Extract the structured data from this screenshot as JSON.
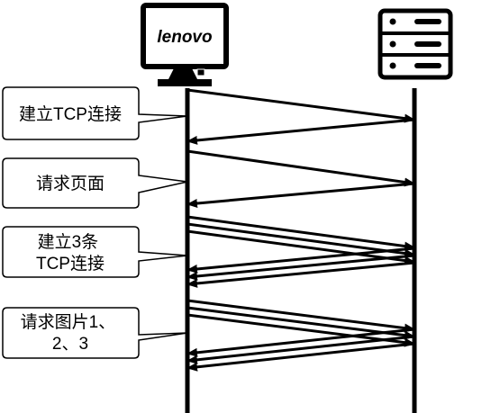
{
  "client": {
    "icon": "monitor-icon",
    "brand_text": "lenovo"
  },
  "server": {
    "icon": "server-rack-icon"
  },
  "steps": [
    {
      "name": "tcp-handshake",
      "lines": [
        "建立TCP连接"
      ],
      "arrows": [
        {
          "from": "client",
          "to": "server"
        },
        {
          "from": "server",
          "to": "client"
        }
      ]
    },
    {
      "name": "request-page",
      "lines": [
        "请求页面"
      ],
      "arrows": [
        {
          "from": "client",
          "to": "server"
        },
        {
          "from": "server",
          "to": "client"
        }
      ]
    },
    {
      "name": "three-tcp-connections",
      "lines": [
        "建立3条",
        "TCP连接"
      ],
      "arrows": [
        {
          "from": "client",
          "to": "server"
        },
        {
          "from": "client",
          "to": "server"
        },
        {
          "from": "client",
          "to": "server"
        },
        {
          "from": "server",
          "to": "client"
        },
        {
          "from": "server",
          "to": "client"
        },
        {
          "from": "server",
          "to": "client"
        }
      ]
    },
    {
      "name": "request-images",
      "lines": [
        "请求图片1、",
        "2、3"
      ],
      "arrows": [
        {
          "from": "client",
          "to": "server"
        },
        {
          "from": "client",
          "to": "server"
        },
        {
          "from": "client",
          "to": "server"
        },
        {
          "from": "server",
          "to": "client"
        },
        {
          "from": "server",
          "to": "client"
        },
        {
          "from": "server",
          "to": "client"
        }
      ]
    }
  ],
  "colors": {
    "stroke": "#000000",
    "background": "#ffffff"
  }
}
